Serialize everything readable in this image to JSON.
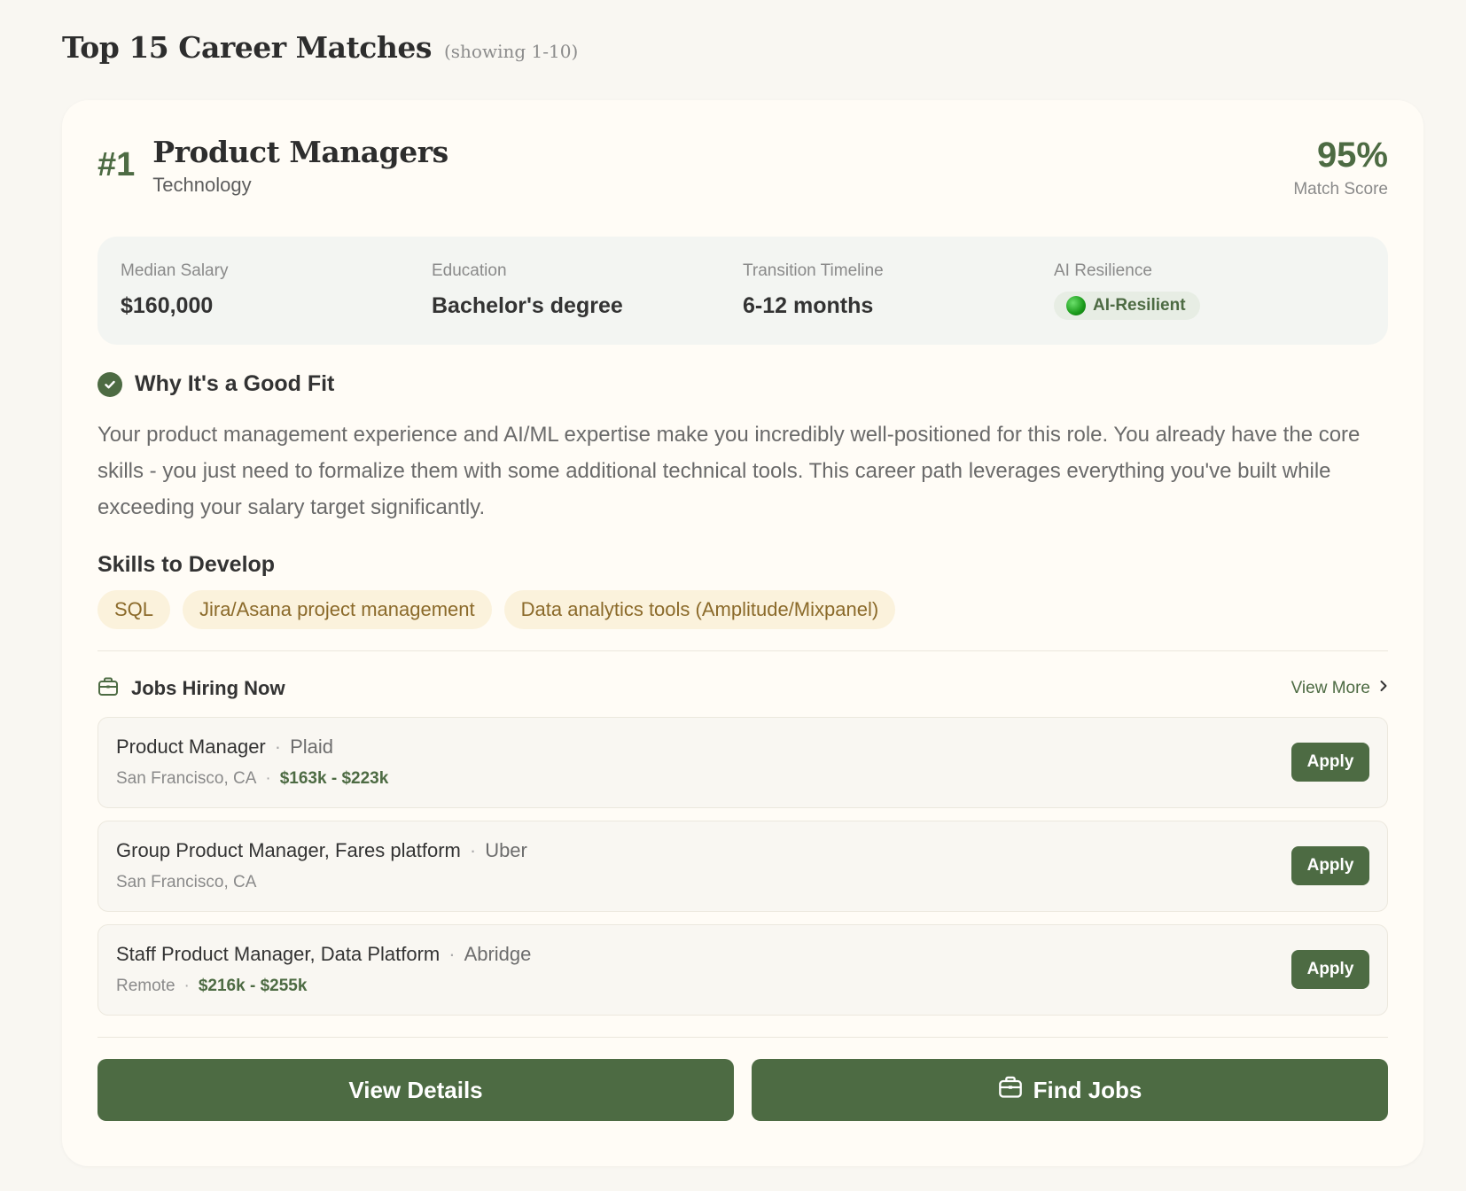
{
  "header": {
    "title": "Top 15 Career Matches",
    "subtitle": "(showing 1-10)"
  },
  "card": {
    "rank": "#1",
    "title": "Product Managers",
    "category": "Technology",
    "score": "95%",
    "score_label": "Match Score",
    "stats": [
      {
        "label": "Median Salary",
        "value": "$160,000"
      },
      {
        "label": "Education",
        "value": "Bachelor's degree"
      },
      {
        "label": "Transition Timeline",
        "value": "6-12 months"
      },
      {
        "label": "AI Resilience",
        "value": "AI-Resilient"
      }
    ],
    "fit_title": "Why It's a Good Fit",
    "fit_body": "Your product management experience and AI/ML expertise make you incredibly well-positioned for this role. You already have the core skills - you just need to formalize them with some additional technical tools. This career path leverages everything you've built while exceeding your salary target significantly.",
    "skills_title": "Skills to Develop",
    "skills": [
      "SQL",
      "Jira/Asana project management",
      "Data analytics tools (Amplitude/Mixpanel)"
    ],
    "jobs_title": "Jobs Hiring Now",
    "view_more": "View More",
    "jobs": [
      {
        "title": "Product Manager",
        "company": "Plaid",
        "location": "San Francisco, CA",
        "salary": "$163k - $223k",
        "apply": "Apply"
      },
      {
        "title": "Group Product Manager, Fares platform",
        "company": "Uber",
        "location": "San Francisco, CA",
        "salary": "",
        "apply": "Apply"
      },
      {
        "title": "Staff Product Manager, Data Platform",
        "company": "Abridge",
        "location": "Remote",
        "salary": "$216k - $255k",
        "apply": "Apply"
      }
    ],
    "actions": {
      "details": "View Details",
      "find_jobs": "Find Jobs"
    }
  },
  "colors": {
    "accent": "#4d6b43",
    "skill_bg": "#fbf2dc",
    "skill_text": "#8b6a2a",
    "background": "#f9f7f2",
    "card": "#fffcf6"
  },
  "icons": {
    "fit": "check-circle-icon",
    "jobs": "briefcase-icon",
    "view_more": "chevron-right-icon",
    "resilience": "green-dot-icon"
  }
}
